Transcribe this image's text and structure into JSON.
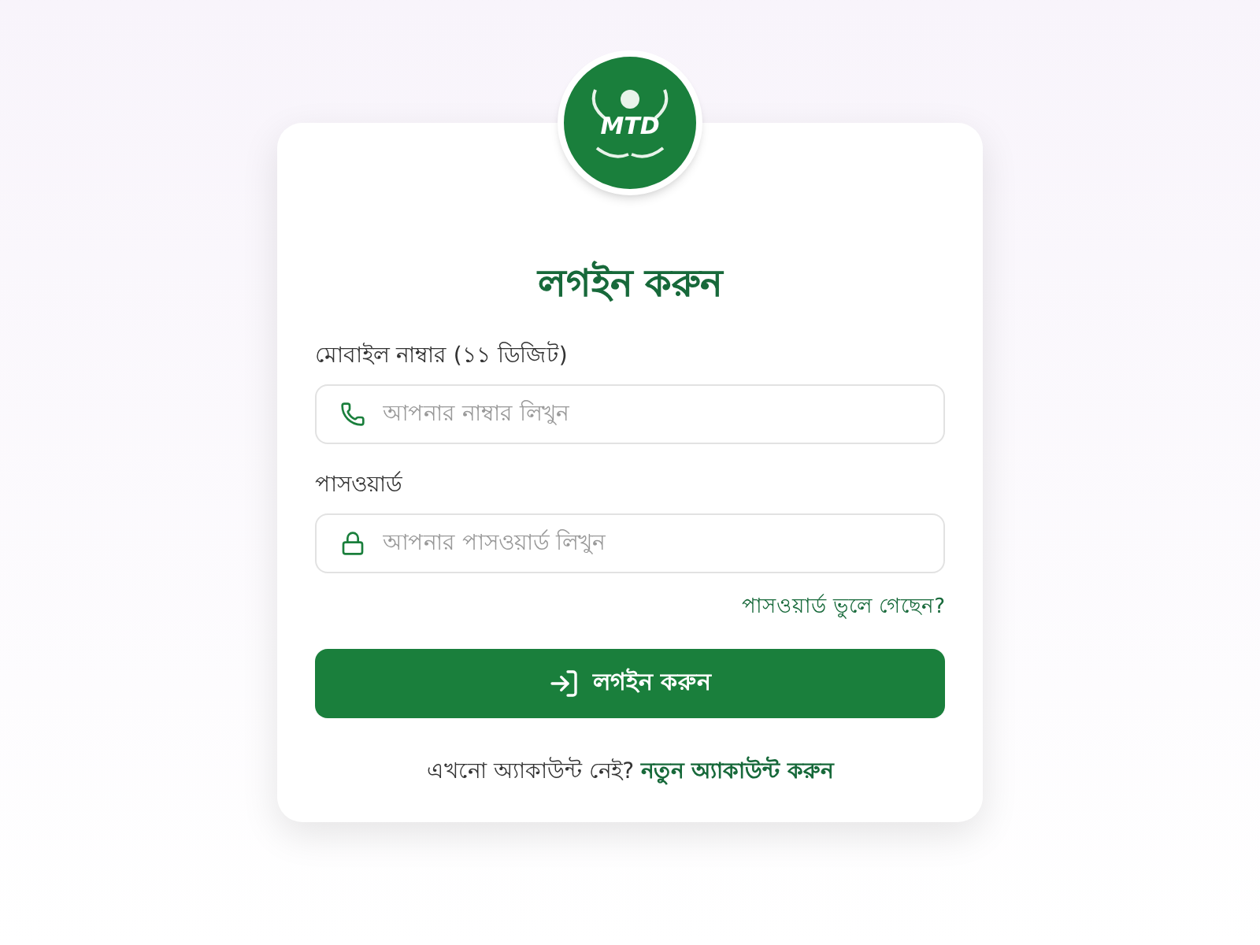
{
  "logo": {
    "text": "MTD"
  },
  "title": "লগইন করুন",
  "fields": [
    {
      "kind": "phone",
      "label": "মোবাইল নাম্বার (১১ ডিজিট)",
      "placeholder": "আপনার নাম্বার লিখুন"
    },
    {
      "kind": "password",
      "label": "পাসওয়ার্ড",
      "placeholder": "আপনার পাসওয়ার্ড লিখুন"
    }
  ],
  "forgot_link": "পাসওয়ার্ড ভুলে গেছেন?",
  "login_button": "লগইন করুন",
  "signup": {
    "text": "এখনো অ্যাকাউন্ট নেই?",
    "link": "নতুন অ্যাকাউন্ট করুন"
  }
}
